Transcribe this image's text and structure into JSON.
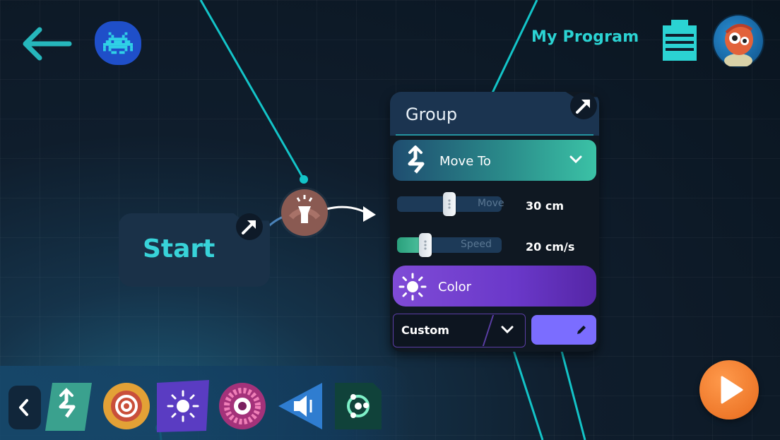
{
  "header": {
    "program_title": "My Program"
  },
  "canvas": {
    "start_label": "Start"
  },
  "group_panel": {
    "title": "Group",
    "move_to": {
      "label": "Move To"
    },
    "move_slider": {
      "word": "Move",
      "value": "30 cm",
      "level": 0.5
    },
    "speed_slider": {
      "word": "Speed",
      "value": "20 cm/s",
      "level": 0.27
    },
    "color": {
      "label": "Color"
    },
    "color_mode": {
      "selected": "Custom"
    },
    "swatch_color": "#7b6dff"
  },
  "toolbar": {
    "items": [
      {
        "name": "move-icon",
        "color": "#3aa18e"
      },
      {
        "name": "sound-icon",
        "color": "#e3a136"
      },
      {
        "name": "light-icon",
        "color": "#5a3cc2"
      },
      {
        "name": "eye-icon",
        "color": "#a4327a"
      },
      {
        "name": "speaker-icon",
        "color": "#2f7dd0"
      },
      {
        "name": "sensor-icon",
        "color": "#10423a"
      }
    ]
  },
  "colors": {
    "accent": "#2bd3d3",
    "play": "#f07a25",
    "annotation_line": "#13c4c8"
  }
}
